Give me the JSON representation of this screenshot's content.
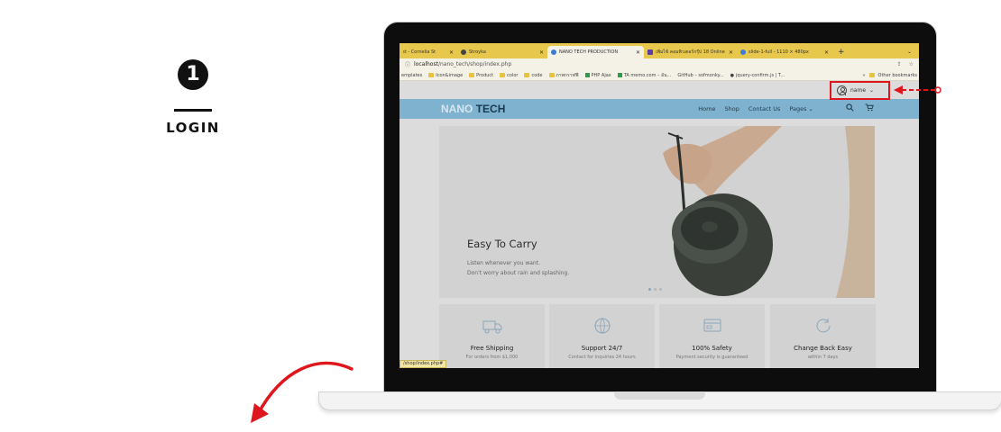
{
  "step": {
    "number": "1",
    "label": "LOGIN"
  },
  "browser": {
    "tabs": [
      {
        "label": "ɪt - Cornelia St",
        "active": false
      },
      {
        "label": "Stroyka",
        "active": false
      },
      {
        "label": "NANO TECH PRODUCTION",
        "active": true
      },
      {
        "label": "เพิ่มไข้ คอมพิวเตอร์กรุ๊ป 18 Online",
        "active": false
      },
      {
        "label": "slide-1-full - 1110 × 480px",
        "active": false
      }
    ],
    "new_tab": "+",
    "url_host": "localhost",
    "url_path": "/nano_tech/shop/index.php",
    "bookmarks": [
      "emplates",
      "Icon&image",
      "Product",
      "color",
      "code",
      "ภาพกราฟฟี",
      "PHP Ajax",
      "TA memo.com – อัน...",
      "GitHub – sofmonky...",
      "jquery-confirm.js | T..."
    ],
    "other_bookmarks": "Other bookmarks"
  },
  "site": {
    "logo_part1": "NANO",
    "logo_part2": "TECH",
    "user_name": "name",
    "nav": [
      "Home",
      "Shop",
      "Contact Us",
      "Pages"
    ],
    "hero_title": "Easy To Carry",
    "hero_line1": "Listen whenever you want.",
    "hero_line2": "Don't worry about rain and splashing.",
    "features": [
      {
        "title": "Free Shipping",
        "sub": "For orders from $1,000"
      },
      {
        "title": "Support 24/7",
        "sub": "Contact for inquiries 24 hours"
      },
      {
        "title": "100% Safety",
        "sub": "Payment security is guaranteed"
      },
      {
        "title": "Change Back Easy",
        "sub": "within 7 days"
      }
    ],
    "status_url": "/shop/index.php#"
  },
  "colors": {
    "accent_red": "#e0161e",
    "nav_bg": "#7fb2cf",
    "tab_bar": "#e8c84c"
  }
}
